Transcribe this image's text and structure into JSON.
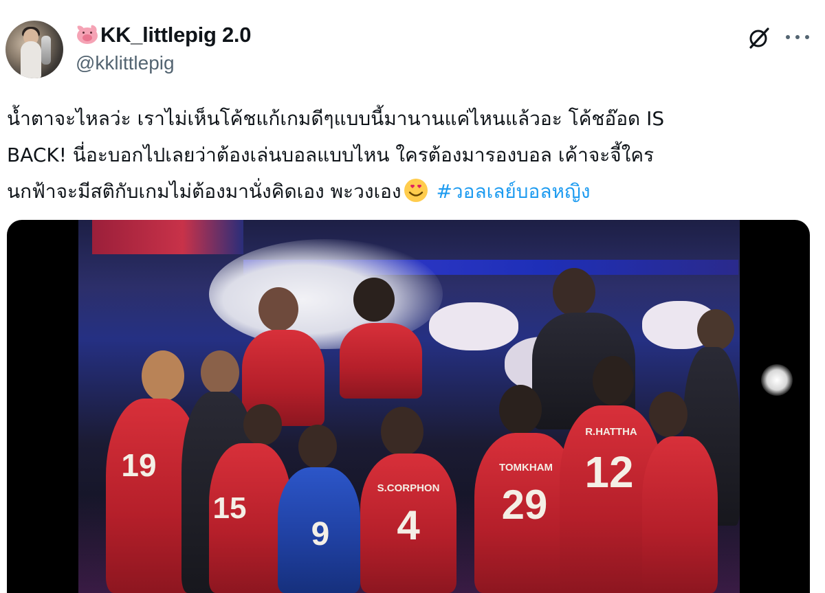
{
  "tweet": {
    "author": {
      "display_name": "KK_littlepig 2.0",
      "handle": "@kklittlepig",
      "name_emoji": "pig-face-icon",
      "avatar": "profile-avatar"
    },
    "actions": {
      "grok_icon": "grok-slash-icon",
      "more_icon": "more-options-icon",
      "more_label": "···"
    },
    "text_lines": [
      "น้ำตาจะไหลว่ะ เราไม่เห็นโค้ชแก้เกมดีๆแบบนี้มานานแค่ไหนแล้วอะ โค้ชอ๊อด IS",
      "BACK! นี่อะบอกไปเลยว่าต้องเล่นบอลแบบไหน ใครต้องมารองบอล เค้าจะจี้ใคร",
      "นกฟ้าจะมีสติกับเกมไม่ต้องมานั่งคิดเอง พะวงเอง"
    ],
    "inline_emoji": "smiling-face-with-heart-eyes-icon",
    "hashtag": "#วอลเลย์บอลหญิง",
    "colors": {
      "text": "#0f1419",
      "secondary": "#536471",
      "link": "#1d9bf0"
    },
    "media": {
      "type": "video",
      "jersey_names": [
        "S.CORPHON",
        "TOMKHAM",
        "R.HATTHA"
      ],
      "jersey_numbers": [
        "4",
        "29",
        "12",
        "9",
        "15",
        "19"
      ]
    }
  }
}
